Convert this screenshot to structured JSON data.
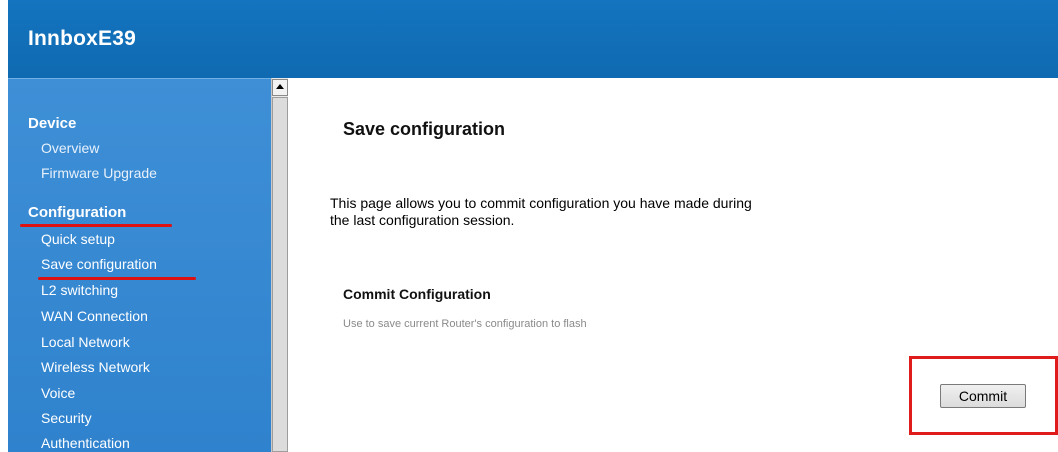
{
  "header": {
    "title": "InnboxE39"
  },
  "sidebar": {
    "sections": [
      {
        "label": "Device",
        "items": [
          "Overview",
          "Firmware Upgrade"
        ]
      },
      {
        "label": "Configuration",
        "items": [
          "Quick setup",
          "Save configuration",
          "L2 switching",
          "WAN Connection",
          "Local Network",
          "Wireless Network",
          "Voice",
          "Security",
          "Authentication"
        ]
      }
    ],
    "highlighted": [
      "Configuration",
      "Save configuration"
    ]
  },
  "main": {
    "title": "Save configuration",
    "description": "This page allows you to commit configuration you have made during the last configuration session.",
    "commit_section": {
      "title": "Commit Configuration",
      "note": "Use to save current Router's configuration to flash"
    },
    "commit_button": "Commit"
  },
  "colors": {
    "header_bg": "#1171bb",
    "sidebar_bg": "#3a8ad3",
    "annotation_red": "#e01b1b"
  }
}
